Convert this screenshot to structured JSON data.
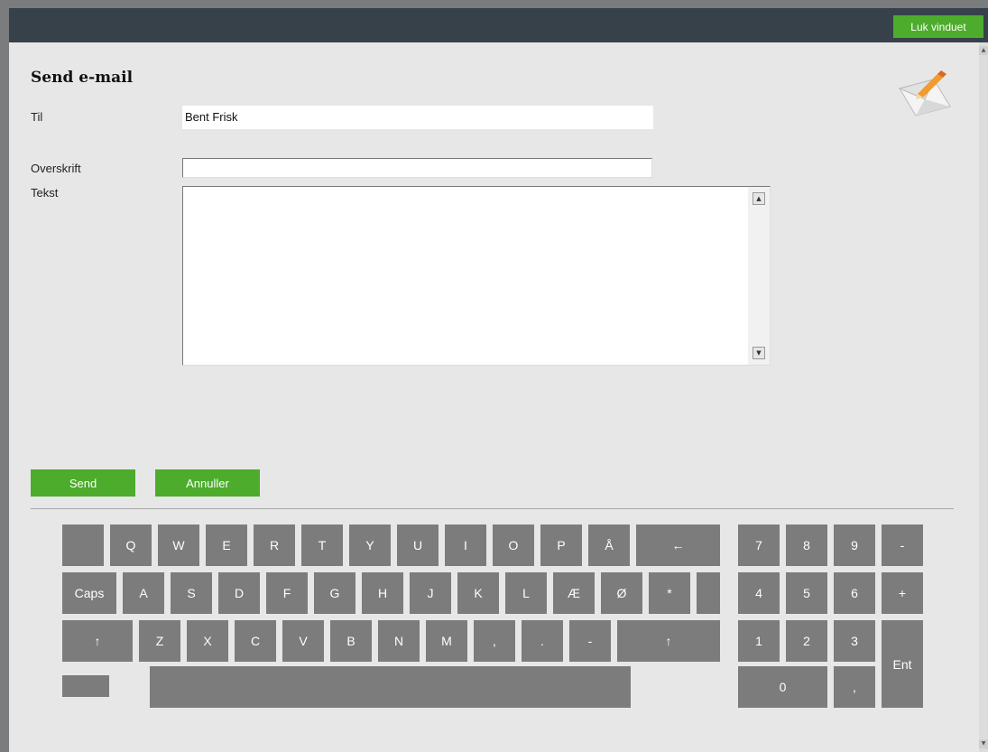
{
  "window": {
    "close_label": "Luk vinduet"
  },
  "form": {
    "title": "Send e-mail",
    "to_label": "Til",
    "to_value": "Bent Frisk",
    "subject_label": "Overskrift",
    "subject_value": "",
    "text_label": "Tekst",
    "text_value": ""
  },
  "actions": {
    "send_label": "Send",
    "cancel_label": "Annuller"
  },
  "keyboard": {
    "row1": [
      "Q",
      "W",
      "E",
      "R",
      "T",
      "Y",
      "U",
      "I",
      "O",
      "P",
      "Å",
      "←"
    ],
    "row2": [
      "Caps",
      "A",
      "S",
      "D",
      "F",
      "G",
      "H",
      "J",
      "K",
      "L",
      "Æ",
      "Ø",
      "*"
    ],
    "row3": [
      "↑",
      "Z",
      "X",
      "C",
      "V",
      "B",
      "N",
      "M",
      ",",
      ".",
      "-",
      "↑"
    ],
    "numpad": [
      "7",
      "8",
      "9",
      "-",
      "4",
      "5",
      "6",
      "+",
      "1",
      "2",
      "3",
      "Ent",
      "0",
      ","
    ]
  },
  "colors": {
    "accent": "#4dac2c",
    "titlebar": "#36414a",
    "key": "#7c7c7c",
    "panel": "#e7e7e7"
  },
  "icons": {
    "mail": "envelope-pencil-icon"
  }
}
